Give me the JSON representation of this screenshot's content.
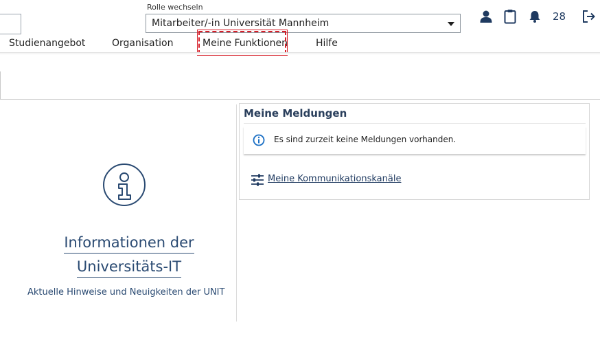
{
  "header": {
    "role_label": "Rolle wechseln",
    "role_value": "Mitarbeiter/-in Universität Mannheim",
    "notification_count": "28"
  },
  "nav": {
    "items": [
      "Studienangebot",
      "Organisation",
      "Meine Funktionen",
      "Hilfe"
    ],
    "highlighted": "Meine Funktionen"
  },
  "info": {
    "title_line1": "Informationen der",
    "title_line2": "Universitäts-IT",
    "subtitle": "Aktuelle Hinweise und Neuigkeiten der UNIT"
  },
  "messages": {
    "title": "Meine Meldungen",
    "empty_text": "Es sind zurzeit keine Meldungen vorhanden.",
    "channels_link": "Meine Kommunikationskanäle"
  },
  "colors": {
    "brand_blue": "#1f3a60",
    "highlight_red": "#d61e28",
    "info_blue": "#1a6fc4"
  },
  "icons": [
    "person-icon",
    "clipboard-icon",
    "bell-icon",
    "logout-icon",
    "info-icon",
    "sliders-icon",
    "chevron-down-icon"
  ]
}
